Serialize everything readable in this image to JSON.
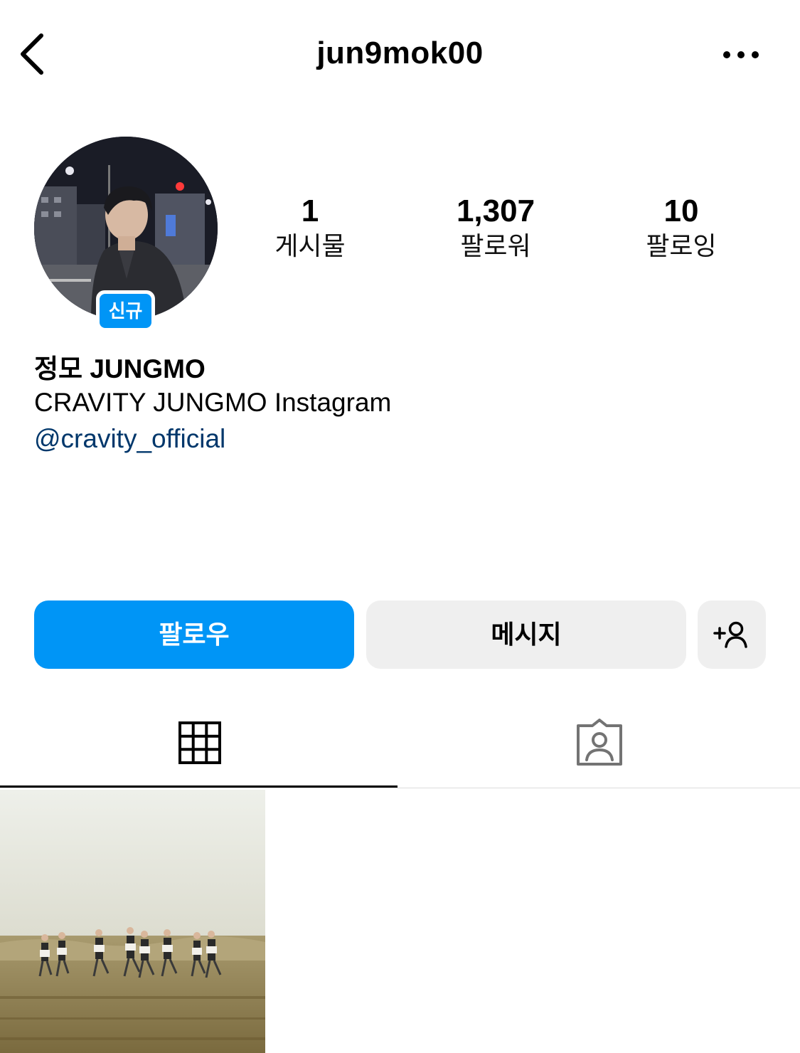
{
  "header": {
    "username": "jun9mok00",
    "back_icon": "chevron-left-icon",
    "more_icon": "ellipsis-icon"
  },
  "profile": {
    "new_badge": "신규",
    "display_name": "정모 JUNGMO",
    "bio": "CRAVITY JUNGMO Instagram",
    "mention": "@cravity_official"
  },
  "stats": {
    "posts": {
      "value": "1",
      "label": "게시물"
    },
    "followers": {
      "value": "1,307",
      "label": "팔로워"
    },
    "following": {
      "value": "10",
      "label": "팔로잉"
    }
  },
  "actions": {
    "follow_label": "팔로우",
    "message_label": "메시지",
    "add_user_icon": "add-person-icon"
  },
  "tabs": [
    {
      "icon": "grid-icon",
      "active": true
    },
    {
      "icon": "tagged-person-icon",
      "active": false
    }
  ],
  "colors": {
    "primary": "#0095f6",
    "link": "#00376b",
    "secondary_button": "#efefef"
  }
}
